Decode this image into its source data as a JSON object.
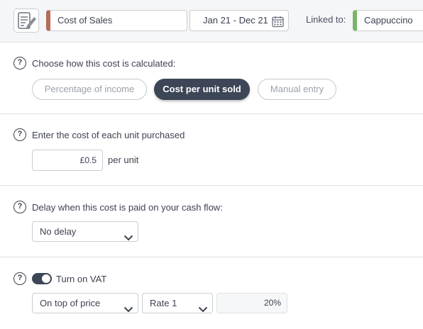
{
  "header": {
    "icon": "document-edit-icon",
    "name": "Cost of Sales",
    "name_color": "#b86b58",
    "date_range": "Jan 21 - Dec 21",
    "date_icon": "calendar-icon",
    "linked_label": "Linked to:",
    "linked_value": "Cappuccino",
    "linked_color": "#7ab56a"
  },
  "calculation": {
    "question": "Choose how this cost is calculated:",
    "options": [
      "Percentage of income",
      "Cost per unit sold",
      "Manual entry"
    ],
    "selected": "Cost per unit sold"
  },
  "unit_cost": {
    "question": "Enter the cost of each unit purchased",
    "value": "£0.5",
    "suffix": "per unit"
  },
  "delay": {
    "question": "Delay when this cost is paid on your cash flow:",
    "value": "No delay"
  },
  "vat": {
    "enabled": true,
    "label": "Turn on VAT",
    "mode": "On top of price",
    "rate": "Rate 1",
    "percent": "20%"
  },
  "help_glyph": "?",
  "colors": {
    "accent_dark": "#3d4656"
  }
}
